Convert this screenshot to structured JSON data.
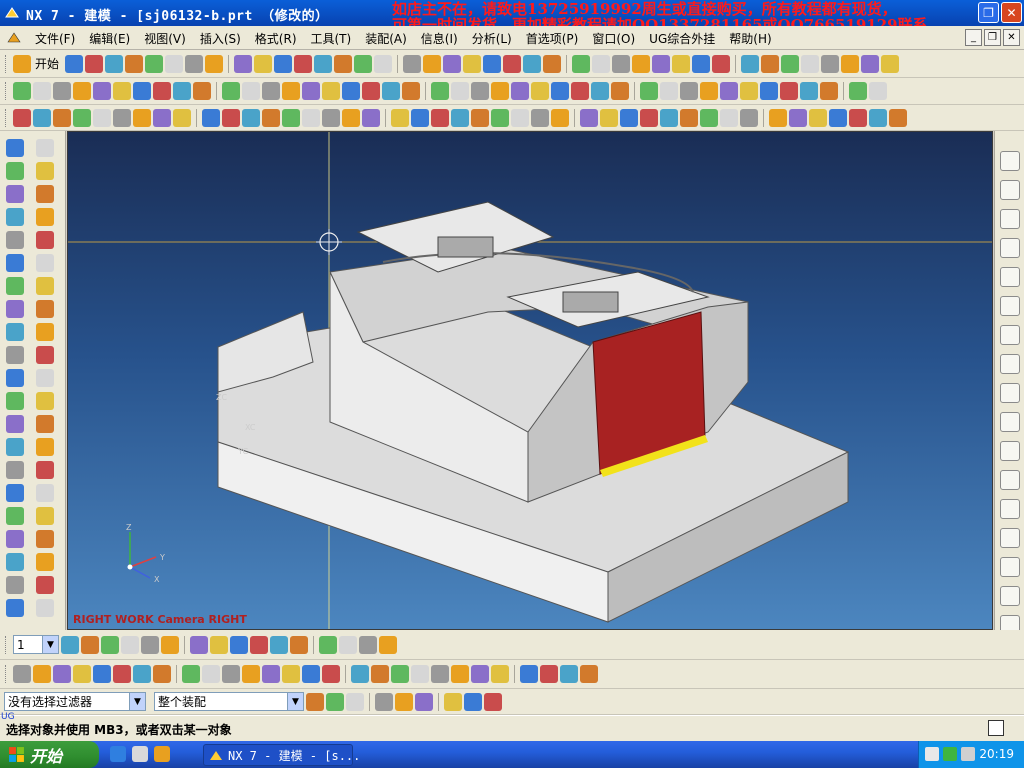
{
  "window": {
    "title": "NX 7 - 建模 - [sj06132-b.prt （修改的）",
    "promo_line1": "如店主不在，请致电13725919992周生或直接购买，所有教程都有现货，",
    "promo_line2": "可第一时间发货，更加精彩教程请加QQ1337281165或QQ766519129联系"
  },
  "menu": {
    "items": [
      "文件(F)",
      "编辑(E)",
      "视图(V)",
      "插入(S)",
      "格式(R)",
      "工具(T)",
      "装配(A)",
      "信息(I)",
      "分析(L)",
      "首选项(P)",
      "窗口(O)",
      "UG综合外挂",
      "帮助(H)"
    ]
  },
  "toolbar": {
    "start_label": "开始",
    "layer_value": "1"
  },
  "viewport": {
    "view_label": "RIGHT WORK Camera RIGHT",
    "axis_labels": {
      "zc": "ZC",
      "xc": "XC",
      "yc": "YC",
      "x": "X",
      "y": "Y",
      "z": "Z"
    }
  },
  "filters": {
    "selection_filter": "没有选择过滤器",
    "assembly_scope": "整个装配"
  },
  "status": {
    "cue_line": "选择对象并使用 MB3，或者双击某一对象",
    "cue_prefix": "UG"
  },
  "taskbar": {
    "start_label": "开始",
    "task_label": "NX 7 - 建模 - [s...",
    "clock": "20:19"
  },
  "colors": {
    "titlebar": "#0842b0",
    "promo_text": "#ff1a1a",
    "selected_face": "#a82222",
    "highlight_edge": "#f2e21a",
    "model": "#d8d8d8",
    "viewport_top": "#1a2d55",
    "viewport_bottom": "#4c86bf"
  }
}
